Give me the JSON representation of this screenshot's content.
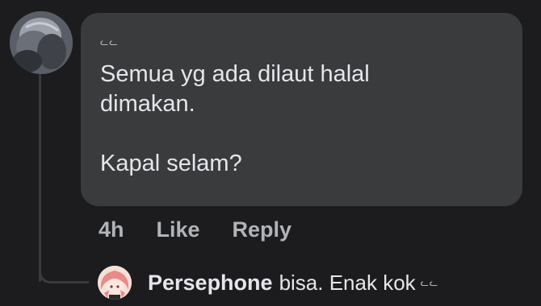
{
  "comment": {
    "author_name": "ᓚᓚ",
    "text": "Semua yg ada dilaut halal\ndimakan.\n\nKapal selam?",
    "time": "4h",
    "like_label": "Like",
    "reply_label": "Reply"
  },
  "reply": {
    "author": "Persephone",
    "text": "bisa. Enak kok",
    "suffix": "ᓚᓚ"
  },
  "colors": {
    "background": "#1c1c1e",
    "bubble": "#3a3b3c",
    "text": "#e4e6eb",
    "muted": "#b0b3b8"
  }
}
